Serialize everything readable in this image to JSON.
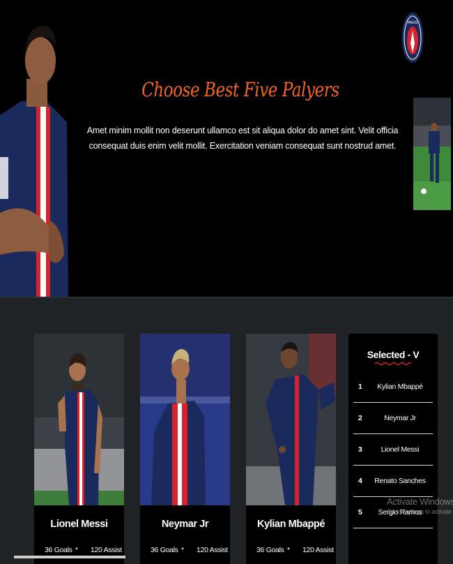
{
  "hero": {
    "title": "Choose Best Five Palyers",
    "description": "Amet minim mollit non deserunt ullamco est sit aliqua dolor do amet sint. Velit officia consequat duis enim velit mollit. Exercitation veniam consequat sunt nostrud amet.",
    "logo_text": "PARIS",
    "colors": {
      "title": "#f26522",
      "hero_bg": "#000000",
      "page_bg": "#1f2326",
      "psg_navy": "#1b2a5c",
      "psg_red": "#d8232a"
    }
  },
  "players": [
    {
      "name": "Lionel Messi",
      "goals": "36 Goals",
      "separator": "*",
      "assist": "120 Assist",
      "photo": "messi-photo"
    },
    {
      "name": "Neymar Jr",
      "goals": "36 Goals",
      "separator": "*",
      "assist": "120 Assist",
      "photo": "neymar-photo"
    },
    {
      "name": "Kylian Mbappé",
      "goals": "36 Goals",
      "separator": "*",
      "assist": "120 Assist",
      "photo": "mbappe-photo"
    }
  ],
  "selected": {
    "title": "Selected - V",
    "items": [
      {
        "num": "1",
        "name": "Kylian Mbappé"
      },
      {
        "num": "2",
        "name": "Neymar Jr"
      },
      {
        "num": "3",
        "name": "Lionel Messi"
      },
      {
        "num": "4",
        "name": "Renato Sanches"
      },
      {
        "num": "5",
        "name": "Sergio Ramos"
      }
    ]
  },
  "watermark": {
    "line1": "Activate Windows",
    "line2": "Go to Settings to activate Windo"
  }
}
